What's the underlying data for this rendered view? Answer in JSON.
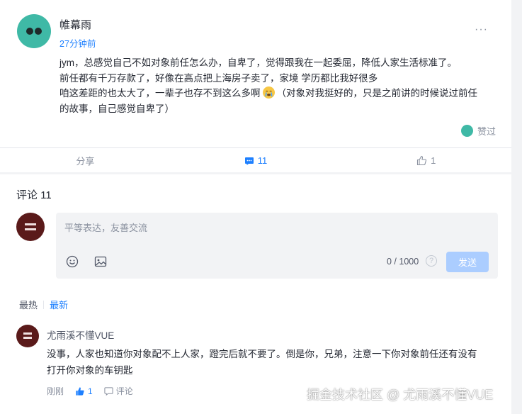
{
  "post": {
    "author": "帷幕雨",
    "time": "27分钟前",
    "more": "···",
    "lines": [
      "jym，总感觉自己不如对象前任怎么办，自卑了，觉得跟我在一起委屈，降低人家生活标准了。",
      "前任都有千万存款了，好像在高点把上海房子卖了，家境 学历都比我好很多",
      "咱这差距的也太大了，一辈子也存不到这么多啊",
      "（对象对我挺好的，只是之前讲的时候说过前任",
      "的故事，自己感觉自卑了）"
    ],
    "emoji": "crying-face",
    "liked_label": "赞过"
  },
  "actions": {
    "share": "分享",
    "comments": "11",
    "likes": "1"
  },
  "comments": {
    "title": "评论 11",
    "input_placeholder": "平等表达，友善交流",
    "counter": "0 / 1000",
    "help": "?",
    "send": "发送",
    "sort_hot": "最热",
    "sort_new": "最新",
    "items": [
      {
        "name": "尤雨溪不懂VUE",
        "lines": [
          "没事，人家也知道你对象配不上人家，蹬完后就不要了。倒是你，兄弟，注意一下你对象前任还有没有",
          "打开你对象的车钥匙"
        ],
        "time": "刚刚",
        "likes": "1",
        "reply": "评论"
      }
    ]
  },
  "watermark": "掘金技术社区 @ 尤雨溪不懂VUE",
  "colors": {
    "accent": "#1e80ff",
    "send_disabled": "#abcdff",
    "avatar_teal": "#3fb9a6"
  }
}
